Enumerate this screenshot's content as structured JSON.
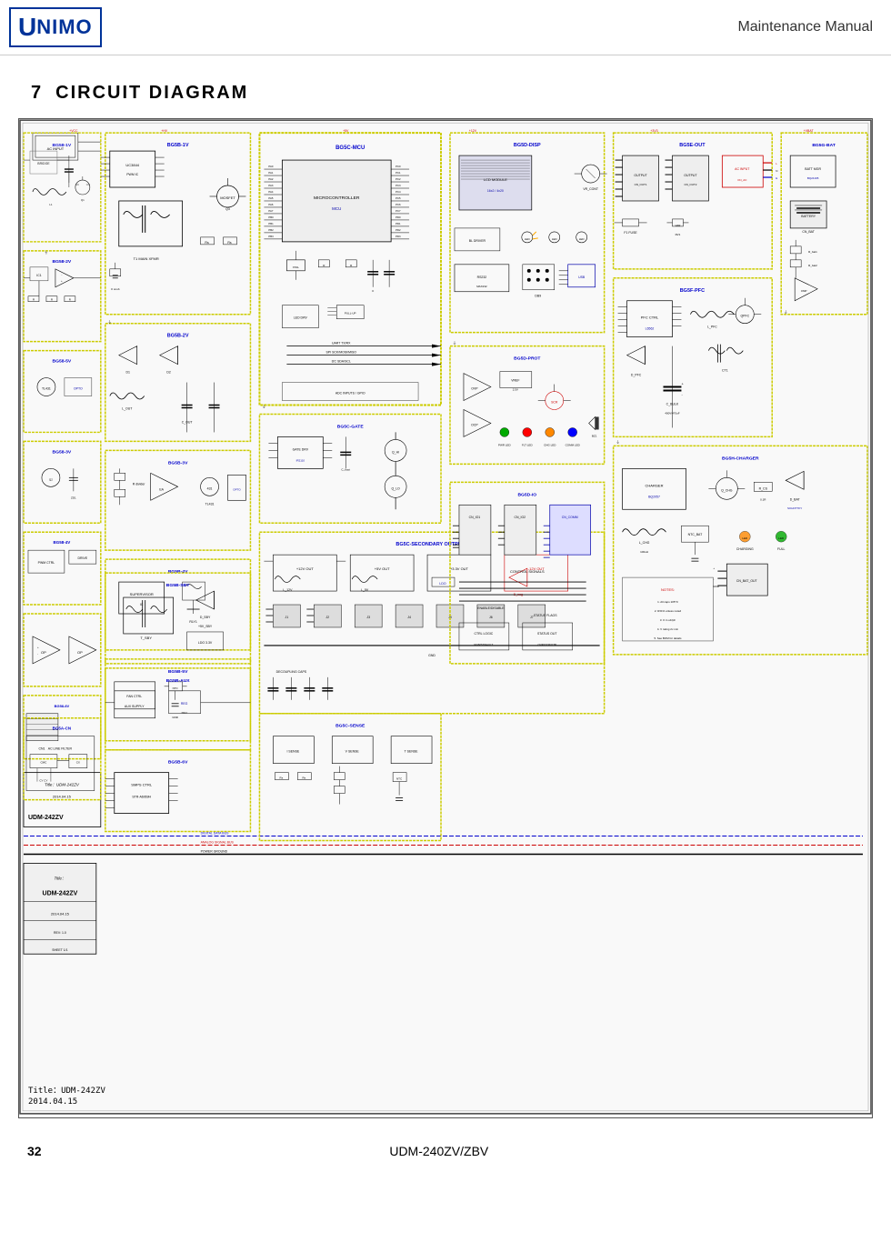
{
  "header": {
    "logo_text": "unimo",
    "title": "Maintenance Manual"
  },
  "section": {
    "number": "7",
    "title": "CIRCUIT DIAGRAM"
  },
  "circuit": {
    "title_label": "Title：UDM-242ZV",
    "date_label": "2014.04.15"
  },
  "footer": {
    "page_number": "32",
    "model_name": "UDM-240ZV/ZBV"
  }
}
